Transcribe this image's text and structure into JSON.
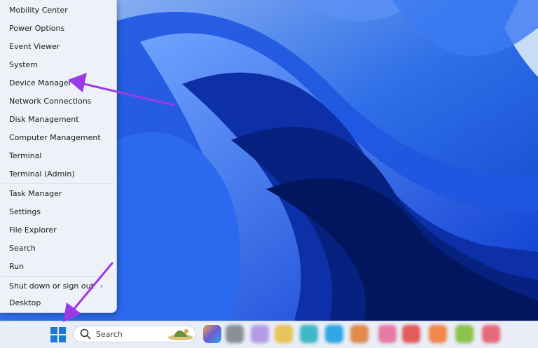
{
  "menu": {
    "items": [
      {
        "label": "Mobility Center"
      },
      {
        "label": "Power Options"
      },
      {
        "label": "Event Viewer"
      },
      {
        "label": "System"
      },
      {
        "label": "Device Manager"
      },
      {
        "label": "Network Connections"
      },
      {
        "label": "Disk Management"
      },
      {
        "label": "Computer Management"
      },
      {
        "label": "Terminal"
      },
      {
        "label": "Terminal (Admin)"
      },
      {
        "label": "Task Manager"
      },
      {
        "label": "Settings"
      },
      {
        "label": "File Explorer"
      },
      {
        "label": "Search"
      },
      {
        "label": "Run"
      },
      {
        "label": "Shut down or sign out",
        "has_submenu": true
      },
      {
        "label": "Desktop"
      }
    ]
  },
  "taskbar": {
    "search_placeholder": "Search",
    "icons": [
      {
        "name": "copilot-icon",
        "color": "#6a5cd6"
      },
      {
        "name": "app-icon-gray",
        "color": "#8a8f98"
      },
      {
        "name": "app-icon-purple",
        "color": "#b59be6"
      },
      {
        "name": "app-icon-yellow",
        "color": "#e7c35a"
      },
      {
        "name": "app-icon-teal",
        "color": "#3fb7c7"
      },
      {
        "name": "app-icon-cyan",
        "color": "#2fa6e6"
      },
      {
        "name": "app-icon-multicolor",
        "color": "#e08a4d"
      },
      {
        "name": "app-icon-pink",
        "color": "#e47aa0"
      },
      {
        "name": "app-icon-red",
        "color": "#e35b5b"
      },
      {
        "name": "app-icon-orange",
        "color": "#f0884a"
      },
      {
        "name": "app-icon-green",
        "color": "#8bc34a"
      },
      {
        "name": "app-icon-rose",
        "color": "#e86a7a"
      }
    ]
  },
  "annotations": {
    "arrow_color": "#9a3be6"
  }
}
